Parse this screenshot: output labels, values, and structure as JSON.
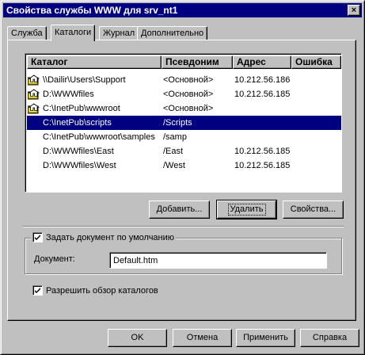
{
  "window": {
    "title": "Свойства службы WWW для srv_nt1",
    "close_glyph": "×"
  },
  "tabs": [
    {
      "label": "Служба"
    },
    {
      "label": "Каталоги"
    },
    {
      "label": "Журнал"
    },
    {
      "label": "Дополнительно"
    }
  ],
  "list": {
    "columns": [
      "Каталог",
      "Псевдоним",
      "Адрес",
      "Ошибка"
    ],
    "rows": [
      {
        "icon": "home-directory-icon",
        "dir": "\\\\Dailir\\Users\\Support",
        "alias": "<Основной>",
        "address": "10.212.56.186",
        "error": ""
      },
      {
        "icon": "home-directory-icon",
        "dir": "D:\\WWWfiles",
        "alias": "<Основной>",
        "address": "10.212.56.185",
        "error": ""
      },
      {
        "icon": "home-directory-icon",
        "dir": "C:\\InetPub\\wwwroot",
        "alias": "<Основной>",
        "address": "",
        "error": ""
      },
      {
        "icon": "",
        "dir": "C:\\InetPub\\scripts",
        "alias": "/Scripts",
        "address": "",
        "error": ""
      },
      {
        "icon": "",
        "dir": "C:\\InetPub\\wwwroot\\samples",
        "alias": "/samp",
        "address": "",
        "error": ""
      },
      {
        "icon": "",
        "dir": "D:\\WWWfiles\\East",
        "alias": "/East",
        "address": "10.212.56.185",
        "error": ""
      },
      {
        "icon": "",
        "dir": "D:\\WWWfiles\\West",
        "alias": "/West",
        "address": "10.212.56.185",
        "error": ""
      }
    ],
    "selected_index": 3
  },
  "list_buttons": {
    "add": "Добавить...",
    "remove": "Удалить",
    "properties": "Свойства..."
  },
  "default_doc": {
    "checkbox_label": "Задать документ по умолчанию",
    "checked": true,
    "doc_label": "Документ:",
    "doc_value": "Default.htm"
  },
  "browse": {
    "checkbox_label": "Разрешить обзор каталогов",
    "checked": true
  },
  "footer": {
    "ok": "OK",
    "cancel": "Отмена",
    "apply": "Применить",
    "help": "Справка"
  }
}
